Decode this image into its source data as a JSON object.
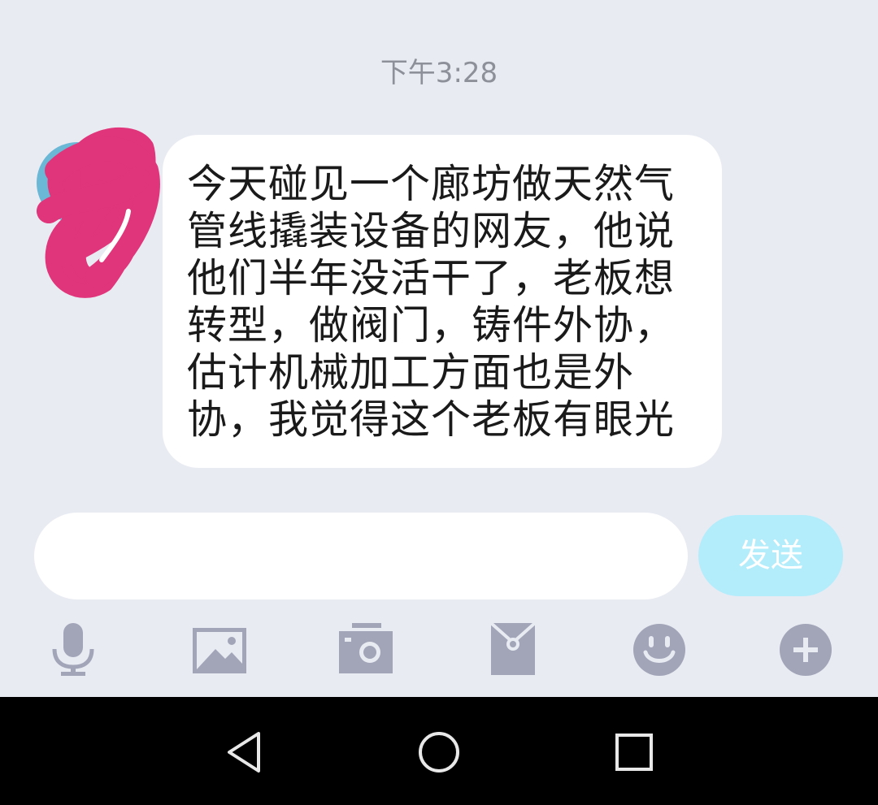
{
  "chat": {
    "timestamp": "下午3:28",
    "messages": [
      {
        "sender": "other",
        "text": "今天碰见一个廊坊做天然气\n管线撬装设备的网友，他说\n他们半年没活干了，老板想\n转型，做阀门，铸件外协，\n估计机械加工方面也是外\n协，我觉得这个老板有眼光"
      }
    ]
  },
  "input": {
    "value": "",
    "placeholder": ""
  },
  "send_button": {
    "label": "发送",
    "color": "#b3ecfb"
  },
  "toolbar": {
    "icons": [
      "microphone-icon",
      "image-icon",
      "camera-icon",
      "red-packet-icon",
      "emoji-icon",
      "plus-icon"
    ],
    "icon_color": "#a2a5b8"
  },
  "nav": {
    "icons": [
      "back-icon",
      "home-icon",
      "recents-icon"
    ]
  },
  "colors": {
    "background": "#e9ebf3",
    "bubble": "#ffffff",
    "redaction": "#e0357a"
  }
}
